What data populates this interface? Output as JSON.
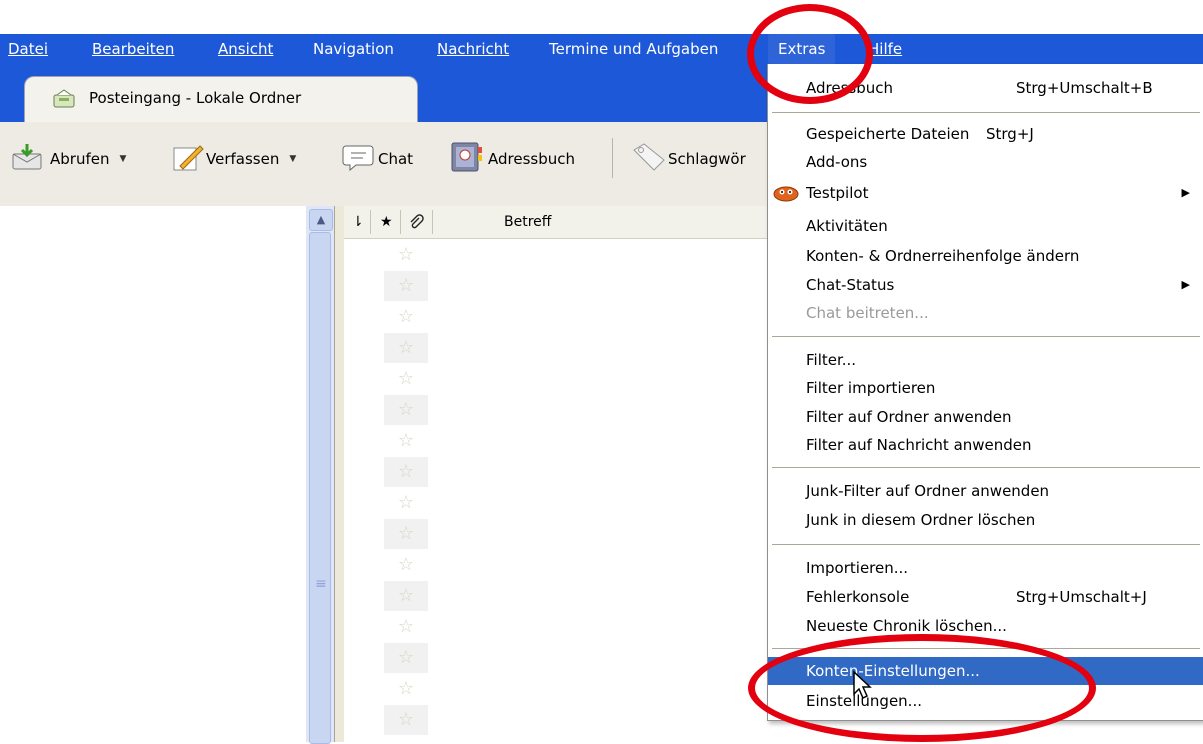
{
  "menubar": {
    "items": [
      {
        "label": "Datei"
      },
      {
        "label": "Bearbeiten"
      },
      {
        "label": "Ansicht"
      },
      {
        "label": "Navigation"
      },
      {
        "label": "Nachricht"
      },
      {
        "label": "Termine und Aufgaben"
      },
      {
        "label": "Extras"
      },
      {
        "label": "Hilfe"
      }
    ]
  },
  "tab": {
    "label": "Posteingang - Lokale Ordner"
  },
  "toolbar": {
    "abrufen": "Abrufen",
    "verfassen": "Verfassen",
    "chat": "Chat",
    "adressbuch": "Adressbuch",
    "schlagwoerter": "Schlagwör"
  },
  "columns": {
    "betreff": "Betreff"
  },
  "menu": {
    "items": [
      {
        "label": "Adressbuch",
        "shortcut": "Strg+Umschalt+B"
      },
      {
        "label": "Gespeicherte Dateien",
        "shortcut": "Strg+J"
      },
      {
        "label": "Add-ons"
      },
      {
        "label": "Testpilot"
      },
      {
        "label": "Aktivitäten"
      },
      {
        "label": "Konten- & Ordnerreihenfolge ändern"
      },
      {
        "label": "Chat-Status"
      },
      {
        "label": "Chat beitreten..."
      },
      {
        "label": "Filter..."
      },
      {
        "label": "Filter importieren"
      },
      {
        "label": "Filter auf Ordner anwenden"
      },
      {
        "label": "Filter auf Nachricht anwenden"
      },
      {
        "label": "Junk-Filter auf Ordner anwenden"
      },
      {
        "label": "Junk in diesem Ordner löschen"
      },
      {
        "label": "Importieren..."
      },
      {
        "label": "Fehlerkonsole",
        "shortcut": "Strg+Umschalt+J"
      },
      {
        "label": "Neueste Chronik löschen..."
      },
      {
        "label": "Konten-Einstellungen..."
      },
      {
        "label": "Einstellungen..."
      }
    ]
  },
  "colors": {
    "menubar": "#1d58d8",
    "highlight": "#316ac5",
    "annotation": "#e3000f"
  }
}
